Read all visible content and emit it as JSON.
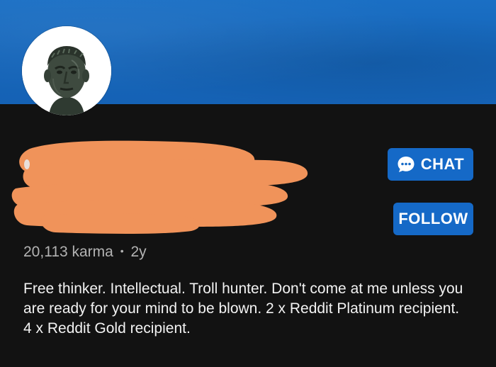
{
  "profile": {
    "karma": "20,113 karma",
    "separator": "•",
    "age": "2y",
    "bio": "Free thinker. Intellectual. Troll hunter. Don't come at me unless you are ready for your mind to be blown. 2 x Reddit Platinum recipient. 4 x Reddit Gold recipient."
  },
  "actions": {
    "chat_label": "CHAT",
    "follow_label": "FOLLOW"
  },
  "icons": {
    "chat": "chat-bubble-icon",
    "avatar": "bronze-bust-avatar"
  },
  "colors": {
    "banner": "#1565b9",
    "background": "#121212",
    "button": "#1569c7",
    "redaction": "#f0935a"
  }
}
